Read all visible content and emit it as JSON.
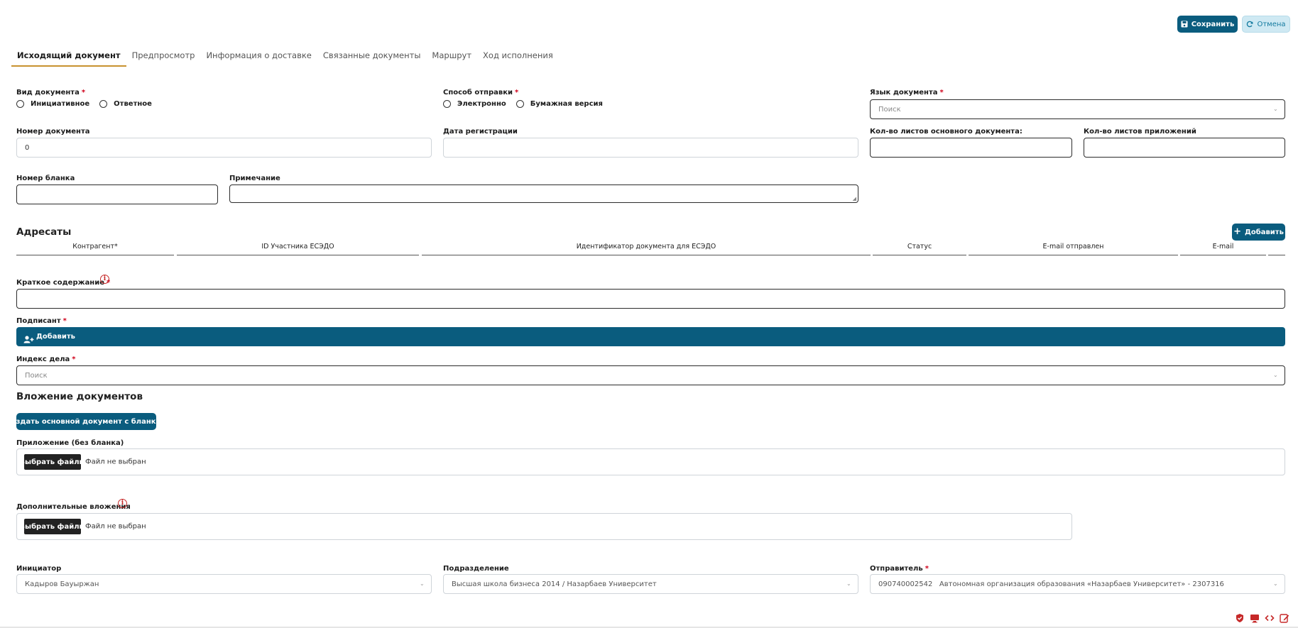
{
  "header": {
    "save_label": "Сохранить",
    "cancel_label": "Отмена"
  },
  "tabs": [
    {
      "label": "Исходящий документ",
      "active": true
    },
    {
      "label": "Предпросмотр"
    },
    {
      "label": "Информация о доставке"
    },
    {
      "label": "Связанные документы"
    },
    {
      "label": "Маршрут"
    },
    {
      "label": "Ход исполнения"
    }
  ],
  "form": {
    "doc_type": {
      "label": "Вид документа",
      "required": "*",
      "options": [
        "Инициативное",
        "Ответное"
      ]
    },
    "send_method": {
      "label": "Способ отправки",
      "required": "*",
      "options": [
        "Электронно",
        "Бумажная версия"
      ]
    },
    "doc_language": {
      "label": "Язык документа",
      "required": "*",
      "placeholder": "Поиск"
    },
    "doc_number": {
      "label": "Номер документа",
      "value": "0"
    },
    "reg_date": {
      "label": "Дата регистрации",
      "value": ""
    },
    "main_sheets": {
      "label": "Кол-во листов основного документа:",
      "value": ""
    },
    "attach_sheets": {
      "label": "Кол-во листов приложений",
      "value": ""
    },
    "blank_number": {
      "label": "Номер бланка",
      "value": ""
    },
    "note": {
      "label": "Примечание",
      "value": ""
    }
  },
  "addressees": {
    "title": "Адресаты",
    "add_label": "Добавить",
    "columns": [
      "Контрагент*",
      "ID Участника ЕСЭДО",
      "Идентификатор документа для ЕСЭДО",
      "Статус",
      "E-mail отправлен",
      "E-mail",
      ""
    ]
  },
  "summary": {
    "label": "Краткое содержание",
    "required": "*",
    "value": ""
  },
  "signer": {
    "label": "Подписант",
    "required": "*",
    "add_label": "Добавить"
  },
  "case_index": {
    "label": "Индекс дела",
    "required": "*",
    "placeholder": "Поиск"
  },
  "attachments": {
    "title": "Вложение документов",
    "create_button": "Создать основной документ с бланком",
    "appendix_label": "Приложение (без бланка)",
    "extra_label": "Дополнительные вложения",
    "choose_files": "Выбрать файлы",
    "no_file": "Файл не выбран"
  },
  "footer_fields": {
    "initiator": {
      "label": "Инициатор",
      "value": "Кадыров Бауыржан"
    },
    "department": {
      "label": "Подразделение",
      "value": "Высшая школа бизнеса 2014 / Назарбаев Университет"
    },
    "sender": {
      "label": "Отправитель",
      "required": "*",
      "value": "090740002542   Автономная организация образования «Назарбаев Университет» - 2307316"
    }
  },
  "colors": {
    "primary": "#0a5c7e",
    "light_button": "#cfe9f3",
    "tab_underline": "#c8922f",
    "required": "#d0021b"
  }
}
